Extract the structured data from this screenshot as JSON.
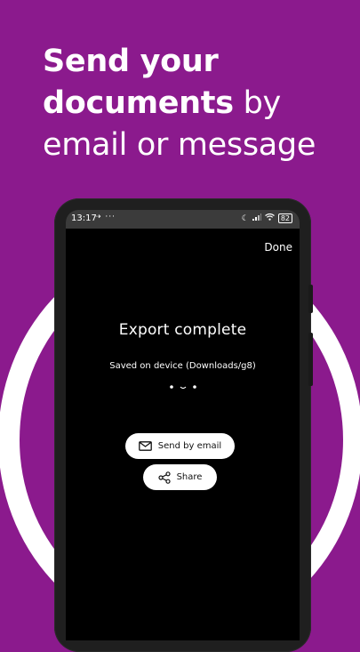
{
  "headline": {
    "bold_text": "Send your documents",
    "regular_text": "by email or message"
  },
  "status_bar": {
    "time": "13:17",
    "left_icons": "⇢ ···",
    "battery": "82"
  },
  "top_action": {
    "done_label": "Done"
  },
  "export": {
    "title": "Export complete",
    "subtitle": "Saved on device (Downloads/g8)"
  },
  "buttons": {
    "email_label": "Send by email",
    "share_label": "Share"
  },
  "colors": {
    "background": "#8b1a8d",
    "circle": "#ffffff",
    "screen": "#000000"
  }
}
